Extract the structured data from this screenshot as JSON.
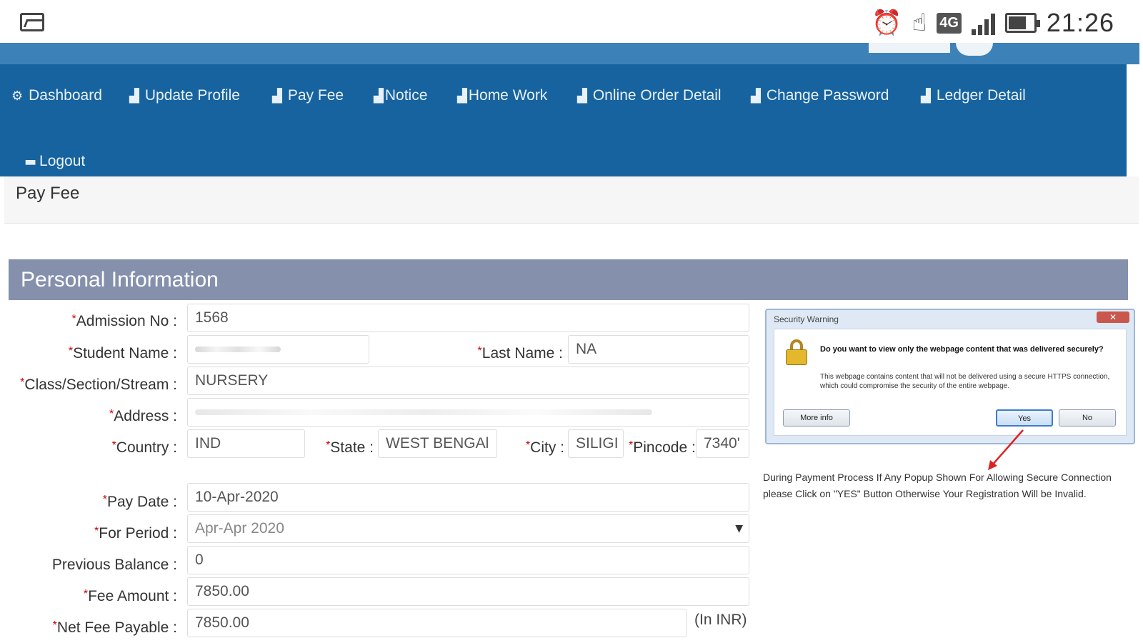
{
  "status_bar": {
    "time": "21:26",
    "network": "4G",
    "icons": [
      "gallery-icon",
      "alarm-icon",
      "touch-icon",
      "signal-icon",
      "battery-icon"
    ]
  },
  "nav": {
    "items": [
      {
        "label": "Dashboard",
        "icon": "dashboard-icon"
      },
      {
        "label": "Update Profile",
        "icon": "chart-icon"
      },
      {
        "label": "Pay Fee",
        "icon": "chart-icon"
      },
      {
        "label": "Notice",
        "icon": "chart-icon"
      },
      {
        "label": "Home Work",
        "icon": "chart-icon"
      },
      {
        "label": "Online Order Detail",
        "icon": "chart-icon"
      },
      {
        "label": "Change Password",
        "icon": "chart-icon"
      },
      {
        "label": "Ledger Detail",
        "icon": "chart-icon"
      },
      {
        "label": "Logout",
        "icon": "logout-icon"
      }
    ]
  },
  "page": {
    "title": "Pay Fee"
  },
  "section": {
    "title": "Personal Information"
  },
  "form": {
    "admission_no": {
      "label": "Admission No :",
      "value": "1568"
    },
    "student_name": {
      "label": "Student Name :",
      "value": ""
    },
    "last_name": {
      "label": "Last Name :",
      "value": "NA"
    },
    "class_section": {
      "label": "Class/Section/Stream :",
      "value": "NURSERY"
    },
    "address": {
      "label": "Address :",
      "value": ""
    },
    "country": {
      "label": "Country :",
      "value": "IND"
    },
    "state": {
      "label": "State :",
      "value": "WEST BENGAl"
    },
    "city": {
      "label": "City :",
      "value": "SILIGI"
    },
    "pincode": {
      "label": "Pincode :",
      "value": "7340'"
    },
    "pay_date": {
      "label": "Pay Date :",
      "value": "10-Apr-2020"
    },
    "for_period": {
      "label": "For Period :",
      "value": "Apr-Apr 2020"
    },
    "previous_balance": {
      "label": "Previous Balance :",
      "value": "0"
    },
    "fee_amount": {
      "label": "Fee Amount :",
      "value": "7850.00"
    },
    "net_fee_payable": {
      "label": "Net Fee Payable :",
      "value": "7850.00",
      "unit": "(In INR)"
    }
  },
  "security_dialog": {
    "title": "Security Warning",
    "question": "Do you want to view only the webpage content that was delivered securely?",
    "description": "This webpage contains content that will not be delivered using a secure HTTPS connection, which could compromise the security of the entire webpage.",
    "more_info": "More info",
    "yes": "Yes",
    "no": "No"
  },
  "payment_note": "During Payment Process If Any Popup Shown For Allowing Secure Connection please Click on \"YES\" Button Otherwise Your Registration Will be Invalid."
}
